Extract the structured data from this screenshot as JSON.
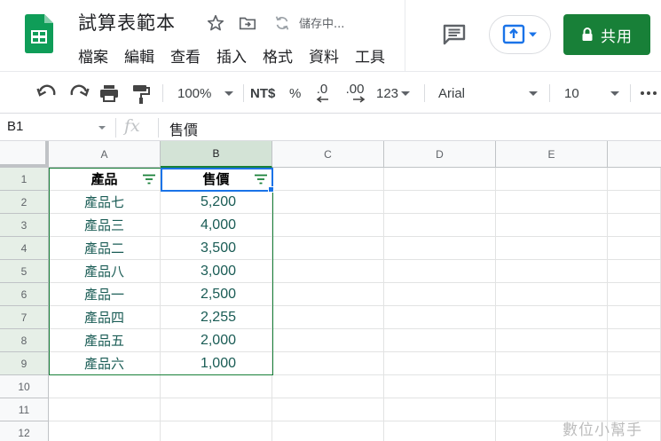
{
  "doc": {
    "title": "試算表範本",
    "status": "儲存中..."
  },
  "menu": [
    "檔案",
    "編輯",
    "查看",
    "插入",
    "格式",
    "資料",
    "工具"
  ],
  "share": {
    "label": "共用"
  },
  "toolbar": {
    "zoom": "100%",
    "currency": "NT$",
    "percent": "%",
    "decrease_decimal": ".0",
    "increase_decimal": ".00",
    "more_formats": "123",
    "font": "Arial",
    "font_size": "10"
  },
  "formula_bar": {
    "cell_ref": "B1",
    "fx": "fx",
    "content": "售價"
  },
  "columns": [
    "A",
    "B",
    "C",
    "D",
    "E"
  ],
  "rows": [
    "1",
    "2",
    "3",
    "4",
    "5",
    "6",
    "7",
    "8",
    "9",
    "10",
    "11",
    "12"
  ],
  "table": {
    "headers": [
      "產品",
      "售價"
    ],
    "data": [
      [
        "產品七",
        "5,200"
      ],
      [
        "產品三",
        "4,000"
      ],
      [
        "產品二",
        "3,500"
      ],
      [
        "產品八",
        "3,000"
      ],
      [
        "產品一",
        "2,500"
      ],
      [
        "產品四",
        "2,255"
      ],
      [
        "產品五",
        "2,000"
      ],
      [
        "產品六",
        "1,000"
      ]
    ]
  },
  "watermark": "數位小幫手",
  "colors": {
    "brand_green": "#188038",
    "selection_blue": "#1a73e8",
    "data_text": "#1a5c55"
  }
}
